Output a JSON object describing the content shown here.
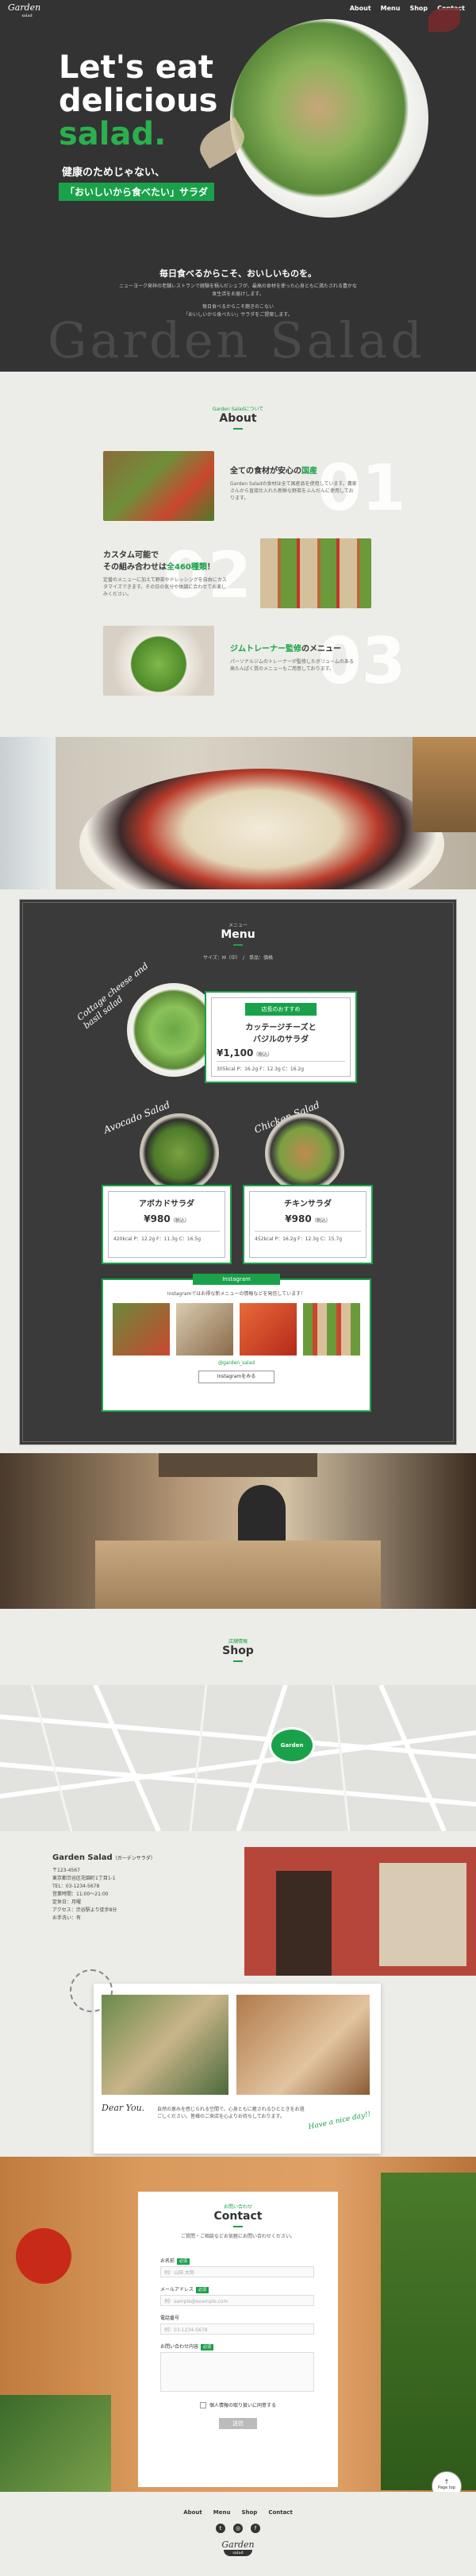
{
  "brand": {
    "logo_main": "Garden",
    "logo_sub": "salad"
  },
  "nav": [
    "About",
    "Menu",
    "Shop",
    "Contact"
  ],
  "hero": {
    "line1": "Let's eat",
    "line2": "delicious",
    "line3": "salad.",
    "sub1": "健康のためじゃない、",
    "sub2": "「おいしいから食べたい」サラダ",
    "intro_title": "毎日食べるからこそ、おいしいものを。",
    "intro_text": [
      "ニューヨーク発祥の老舗レストランで経験を積んだシェフが、最高の食材を使った心身ともに満たされる豊かな食生活をお届けします。",
      "毎日食べるからこそ飽きのこない",
      "「おいしいから食べたい」サラダをご提案します。"
    ],
    "watermark": "Garden Salad"
  },
  "about": {
    "eyebrow": "Garden Saladについて",
    "title": "About",
    "items": [
      {
        "num": "01",
        "head_pre": "全ての食材が安心の",
        "head_hl": "国産",
        "text": "Garden Saladの食材は全て国産品を使用しています。農家さんから直接仕入れた新鮮な野菜をふんだんに使用しております。"
      },
      {
        "num": "02",
        "head_pre": "カスタム可能で",
        "head_pre2": "その組み合わせは",
        "head_hl": "全460種類",
        "head_post": "！",
        "text": "定番のメニューに加えて野菜やドレッシングを自由にカスタマイズできます。その日の気分や体調に合わせてお楽しみください。"
      },
      {
        "num": "03",
        "head_pre": "",
        "head_hl": "ジムトレーナー監修",
        "head_post": "のメニュー",
        "text": "パーソナルジムのトレーナーが監修したボリュームのある高たんぱく質のメニューもご用意しております。"
      }
    ]
  },
  "menu": {
    "eyebrow": "メニュー",
    "title": "Menu",
    "note": "サイズ：M（中）",
    "note2": "単品：価格",
    "featured": {
      "script": "Cottage cheese and basil salad",
      "tag": "店長のおすすめ",
      "name1": "カッテージチーズと",
      "name2": "バジルのサラダ",
      "price": "¥1,100",
      "tax": "（税込）",
      "nutri": "305kcal  P：16.2g  F：12.3g  C：16.2g"
    },
    "items": [
      {
        "script": "Avocado Salad",
        "name": "アボカドサラダ",
        "price": "¥980",
        "tax": "（税込）",
        "nutri": "420kcal  P：12.2g  F：11.3g  C：16.5g"
      },
      {
        "script": "Chicken Salad",
        "name": "チキンサラダ",
        "price": "¥980",
        "tax": "（税込）",
        "nutri": "452kcal  P：16.2g  F：12.3g  C：15.7g"
      }
    ],
    "insta": {
      "tag": "Instagram",
      "text": "Instagramではお得な新メニューの情報などを発信しています！",
      "id": "@garden_salad",
      "button": "Instagramをみる"
    }
  },
  "shop": {
    "eyebrow": "店舗情報",
    "title": "Shop",
    "pin": "Garden",
    "name_pre": "",
    "name": "Garden Salad",
    "name_post": "（ガーデンサラダ）",
    "info": [
      "〒123-4567",
      "東京都渋谷区花園町1丁目1-1",
      "TEL：03-1234-5678",
      "営業時間：11:00〜21:00",
      "定休日：月曜",
      "アクセス：渋谷駅より徒歩8分",
      "お手洗い：有"
    ],
    "postcard_sign": "Dear You.",
    "postcard_script": "Have a nice day!!",
    "postcard_text": "自然の恵みを感じられる空間で、心身ともに癒されるひとときをお過ごしください。皆様のご来店を心よりお待ちしております。"
  },
  "contact": {
    "eyebrow": "お問い合わせ",
    "title": "Contact",
    "lead": "ご質問・ご相談などお気軽にお問い合わせください。",
    "fields": [
      {
        "label": "お名前",
        "req": "必須",
        "ph": "例）山田 太郎"
      },
      {
        "label": "メールアドレス",
        "req": "必須",
        "ph": "例）sample@example.com"
      },
      {
        "label": "電話番号",
        "req": "",
        "ph": "例）03-1234-5678"
      },
      {
        "label": "お問い合わせ内容",
        "req": "必須",
        "ph": ""
      }
    ],
    "consent": "個人情報の取り扱いに同意する",
    "submit": "送信",
    "pagetop": "Page top"
  },
  "footer": {
    "nav": [
      "About",
      "Menu",
      "Shop",
      "Contact"
    ]
  }
}
